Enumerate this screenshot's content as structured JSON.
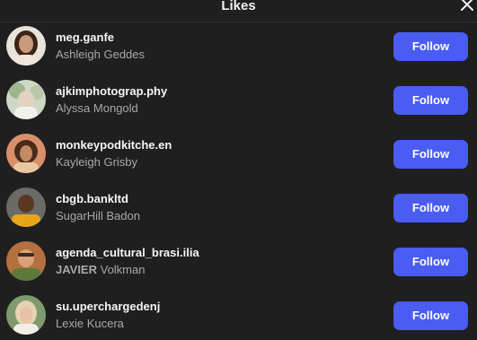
{
  "dialog": {
    "title": "Likes",
    "close_icon": "close-icon"
  },
  "likes": [
    {
      "username": "meg.ganfe",
      "fullname": "Ashleigh Geddes",
      "follow_label": "Follow"
    },
    {
      "username": "ajkimphotograp.phy",
      "fullname": "Alyssa Mongold",
      "follow_label": "Follow"
    },
    {
      "username": "monkeypodkitche.en",
      "fullname": "Kayleigh Grisby",
      "follow_label": "Follow"
    },
    {
      "username": "cbgb.bankltd",
      "fullname": "SugarHill Badon",
      "follow_label": "Follow"
    },
    {
      "username": "agenda_cultural_brasi.ilia",
      "fullname_first": "JAVIER",
      "fullname_rest": " Volkman",
      "follow_label": "Follow"
    },
    {
      "username": "su.uperchargedenj",
      "fullname": "Lexie Kucera",
      "follow_label": "Follow"
    }
  ],
  "colors": {
    "background": "#1f1f20",
    "follow_button": "#4a5cf2",
    "username": "#f5f5f5",
    "fullname": "#a8a8a8"
  }
}
